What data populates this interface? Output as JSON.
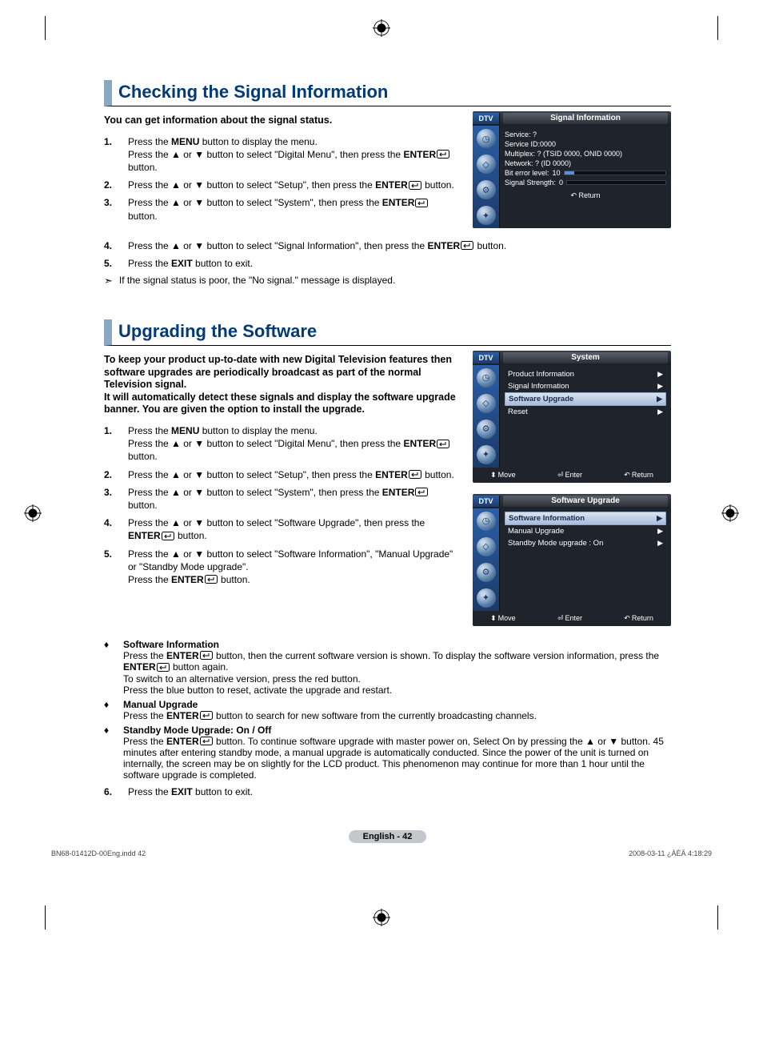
{
  "section1": {
    "heading": "Checking the Signal Information",
    "intro": "You can get information about the signal status.",
    "s1_1a": "Press the ",
    "s1_1b": " button to display the menu.",
    "s1_1c": "Press the ▲ or ▼ button to select \"Digital Menu\", then press the ",
    "s1_1d": " button.",
    "s1_2a": "Press the ▲ or ▼ button to select \"Setup\", then press the ",
    "s1_2b": " button.",
    "s1_3a": "Press the ▲ or ▼ button to select \"System\", then press the ",
    "s1_3b": " button.",
    "s1_4a": "Press the ▲ or ▼ button to select \"Signal Information\", then press the ",
    "s1_4b": " button.",
    "s1_5a": "Press the ",
    "s1_5b": " button to exit.",
    "note": "If the signal status is poor, the \"No signal.\" message is displayed."
  },
  "section2": {
    "heading": "Upgrading the Software",
    "intro1": "To keep your product up-to-date with new Digital Television features then software upgrades are periodically broadcast as part of the normal Television signal.",
    "intro2": "It will automatically detect these signals and display the software upgrade banner. You are given the option to install the upgrade.",
    "s2_1a": "Press the ",
    "s2_1b": " button to display the menu.",
    "s2_1c": "Press the ▲ or ▼ button to select \"Digital Menu\", then press the ",
    "s2_1d": " button.",
    "s2_2a": "Press the ▲ or ▼ button to select \"Setup\", then press the ",
    "s2_2b": " button.",
    "s2_3a": "Press the ▲ or ▼ button to select \"System\", then press the ",
    "s2_3b": " button.",
    "s2_4a": "Press the ▲ or ▼ button to select \"Software Upgrade\", then press the ",
    "s2_4b": " button.",
    "s2_5a": "Press the ▲ or ▼ button to select \"Software Information\", \"Manual Upgrade\" or \"Standby Mode upgrade\".",
    "s2_5b": "Press the ",
    "s2_5c": " button.",
    "bullet1_title": "Software Information",
    "bullet1_a": "Press the ",
    "bullet1_b": " button, then the current software version is shown. To display the software version information, press the ",
    "bullet1_c": " button again.",
    "bullet1_d": "To switch to an alternative version, press the red button.",
    "bullet1_e": "Press the blue button to reset, activate the upgrade and restart.",
    "bullet2_title": "Manual Upgrade",
    "bullet2_a": "Press the ",
    "bullet2_b": " button to search for new software from the currently broadcasting channels.",
    "bullet3_title": "Standby Mode Upgrade: On / Off",
    "bullet3_a": "Press the ",
    "bullet3_b": " button. To continue software upgrade with master power on, Select On by pressing the ▲ or ▼ button. 45 minutes after entering standby mode, a manual upgrade is automatically conducted. Since the power of the unit is turned on internally, the screen may be on slightly for the LCD product. This phenomenon may continue for more than 1 hour until the software upgrade is completed.",
    "s2_6a": "Press the ",
    "s2_6b": " button to exit."
  },
  "labels": {
    "menu": "MENU",
    "enter": "ENTER",
    "exit": "EXIT"
  },
  "osd1": {
    "dtv": "DTV",
    "title": "Signal Information",
    "l1": "Service: ?",
    "l2": "Service ID:0000",
    "l3": "Multiplex: ? (TSID 0000, ONID 0000)",
    "l4": "Network: ? (ID 0000)",
    "bel_label": "Bit error level:",
    "bel_val": "10",
    "ss_label": "Signal Strength:",
    "ss_val": "0",
    "return": "Return"
  },
  "osd2": {
    "dtv": "DTV",
    "title": "System",
    "i1": "Product Information",
    "i2": "Signal Information",
    "i3": "Software Upgrade",
    "i4": "Reset",
    "move": "Move",
    "enter": "Enter",
    "return": "Return"
  },
  "osd3": {
    "dtv": "DTV",
    "title": "Software Upgrade",
    "i1": "Software Information",
    "i2": "Manual Upgrade",
    "i3": "Standby Mode upgrade : On",
    "move": "Move",
    "enter": "Enter",
    "return": "Return"
  },
  "footer": {
    "page": "English - 42",
    "left": "BN68-01412D-00Eng.indd   42",
    "right": "2008-03-11   ¿ÀÈÄ 4:18:29"
  }
}
